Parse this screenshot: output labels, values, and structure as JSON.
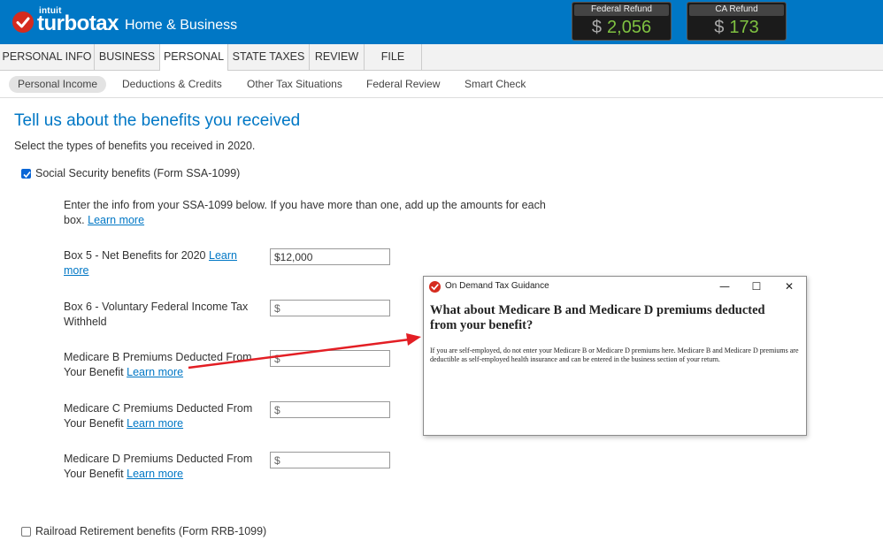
{
  "header": {
    "brand_parent": "intuit",
    "brand": "turbotax",
    "product": "Home & Business",
    "brand_color": "#0077c5",
    "federal_refund": {
      "label": "Federal Refund",
      "currency": "$",
      "amount": "2,056"
    },
    "state_refund": {
      "label": "CA Refund",
      "currency": "$",
      "amount": "173"
    }
  },
  "tabs": [
    {
      "label": "PERSONAL INFO"
    },
    {
      "label": "BUSINESS"
    },
    {
      "label": "PERSONAL",
      "active": true
    },
    {
      "label": "STATE TAXES"
    },
    {
      "label": "REVIEW"
    },
    {
      "label": "FILE"
    }
  ],
  "subnav": [
    {
      "label": "Personal Income",
      "active": true
    },
    {
      "label": "Deductions & Credits"
    },
    {
      "label": "Other Tax Situations"
    },
    {
      "label": "Federal Review"
    },
    {
      "label": "Smart Check"
    }
  ],
  "main": {
    "title": "Tell us about the benefits you received",
    "subtitle": "Select the types of benefits you received in 2020.",
    "ssa": {
      "label": "Social Security benefits (Form SSA-1099)",
      "checked": true,
      "instructions": "Enter the info from your SSA-1099 below. If you have more than one, add up the amounts for each box.",
      "instructions_link": "Learn more",
      "fields": [
        {
          "label": "Box 5 - Net Benefits for 2020",
          "link": "Learn more",
          "value": "$12,000",
          "placeholder": "$"
        },
        {
          "label": "Box 6 - Voluntary Federal Income Tax Withheld",
          "link": "",
          "value": "",
          "placeholder": "$"
        },
        {
          "label": "Medicare B Premiums Deducted From Your Benefit",
          "link": "Learn more",
          "value": "",
          "placeholder": "$"
        },
        {
          "label": "Medicare C Premiums Deducted From Your Benefit",
          "link": "Learn more",
          "value": "",
          "placeholder": "$"
        },
        {
          "label": "Medicare D Premiums Deducted From Your Benefit",
          "link": "Learn more",
          "value": "",
          "placeholder": "$"
        }
      ]
    },
    "rrb": {
      "label": "Railroad Retirement benefits (Form RRB-1099)",
      "checked": false
    }
  },
  "popup": {
    "title": "On Demand Tax Guidance",
    "minimize": "—",
    "maximize": "☐",
    "close": "✕",
    "heading": "What about Medicare B and Medicare D premiums deducted from your benefit?",
    "body": "If you are self-employed, do not enter your Medicare B or Medicare D premiums here. Medicare B and Medicare D premiums are deductible as self-employed health insurance and can be entered in the business section of your return."
  },
  "annotation": {
    "arrow_color": "#e31e24"
  }
}
